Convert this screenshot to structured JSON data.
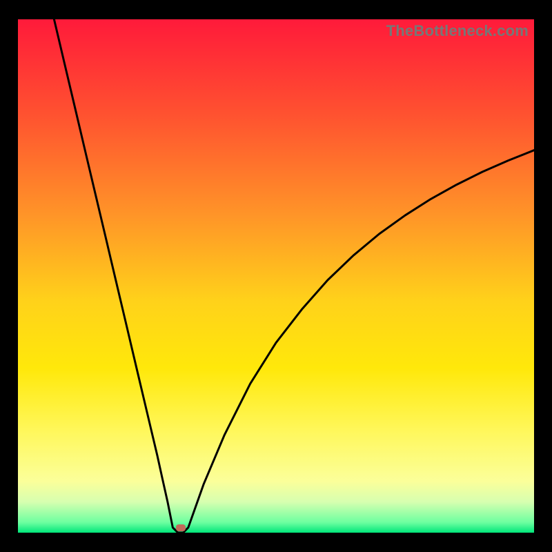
{
  "watermark": "TheBottleneck.com",
  "colors": {
    "background": "#000000",
    "gradient_top": "#ff1a3a",
    "gradient_bottom": "#00e67a",
    "curve": "#000000",
    "dot": "#c16a5a"
  },
  "chart_data": {
    "type": "line",
    "title": "",
    "xlabel": "",
    "ylabel": "",
    "xlim": [
      0,
      1
    ],
    "ylim": [
      0,
      1
    ],
    "annotations": [
      {
        "name": "marker-dot",
        "x": 0.315,
        "y": 0.01
      }
    ],
    "series": [
      {
        "name": "left-branch",
        "x": [
          0.07,
          0.09,
          0.11,
          0.13,
          0.15,
          0.17,
          0.19,
          0.21,
          0.23,
          0.25,
          0.27,
          0.28,
          0.29,
          0.3
        ],
        "values": [
          1.0,
          0.915,
          0.83,
          0.745,
          0.66,
          0.575,
          0.49,
          0.405,
          0.32,
          0.235,
          0.15,
          0.105,
          0.06,
          0.01
        ]
      },
      {
        "name": "valley-floor",
        "x": [
          0.3,
          0.31,
          0.32,
          0.33
        ],
        "values": [
          0.01,
          0.0,
          0.0,
          0.01
        ]
      },
      {
        "name": "right-branch",
        "x": [
          0.33,
          0.36,
          0.4,
          0.45,
          0.5,
          0.55,
          0.6,
          0.65,
          0.7,
          0.75,
          0.8,
          0.85,
          0.9,
          0.95,
          1.0
        ],
        "values": [
          0.01,
          0.095,
          0.19,
          0.29,
          0.37,
          0.435,
          0.492,
          0.54,
          0.582,
          0.618,
          0.65,
          0.678,
          0.703,
          0.725,
          0.745
        ]
      }
    ]
  }
}
